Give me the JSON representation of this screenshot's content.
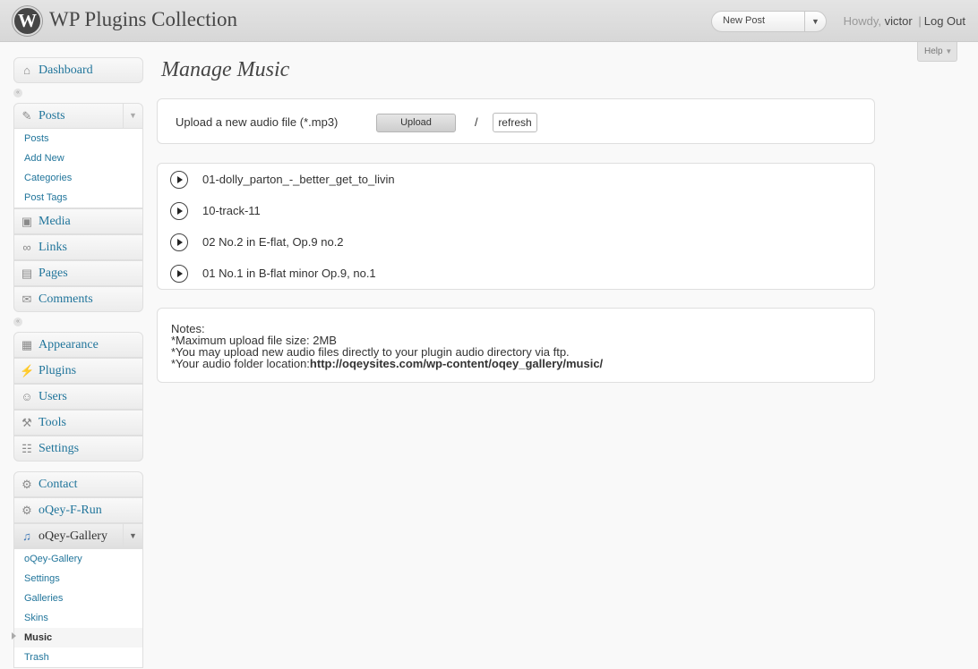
{
  "header": {
    "site_title": "WP Plugins Collection",
    "favorite_action": "New Post",
    "howdy": "Howdy,",
    "username": "victor",
    "separator": "|",
    "logout": "Log Out",
    "help": "Help"
  },
  "menu": {
    "dashboard": "Dashboard",
    "posts": "Posts",
    "posts_sub": [
      "Posts",
      "Add New",
      "Categories",
      "Post Tags"
    ],
    "media": "Media",
    "links": "Links",
    "pages": "Pages",
    "comments": "Comments",
    "appearance": "Appearance",
    "plugins": "Plugins",
    "users": "Users",
    "tools": "Tools",
    "settings": "Settings",
    "contact": "Contact",
    "oqey_frun": "oQey-F-Run",
    "oqey_gallery": "oQey-Gallery",
    "gallery_sub": [
      "oQey-Gallery",
      "Settings",
      "Galleries",
      "Skins",
      "Music",
      "Trash"
    ]
  },
  "page": {
    "title": "Manage Music",
    "upload_label": "Upload a new audio file (*.mp3)",
    "upload_button": "Upload",
    "slash": "/",
    "refresh_button": "refresh",
    "tracks": [
      "01-dolly_parton_-_better_get_to_livin",
      "10-track-11",
      "02 No.2 in E-flat, Op.9 no.2",
      "01 No.1 in B-flat minor Op.9, no.1"
    ],
    "notes": {
      "heading": "Notes:",
      "line1": "*Maximum upload file size: 2MB",
      "line2": "*You may upload new audio files directly to your plugin audio directory via ftp.",
      "line3_prefix": "*Your audio folder location:",
      "line3_path": "http://oqeysites.com/wp-content/oqey_gallery/music/"
    }
  }
}
